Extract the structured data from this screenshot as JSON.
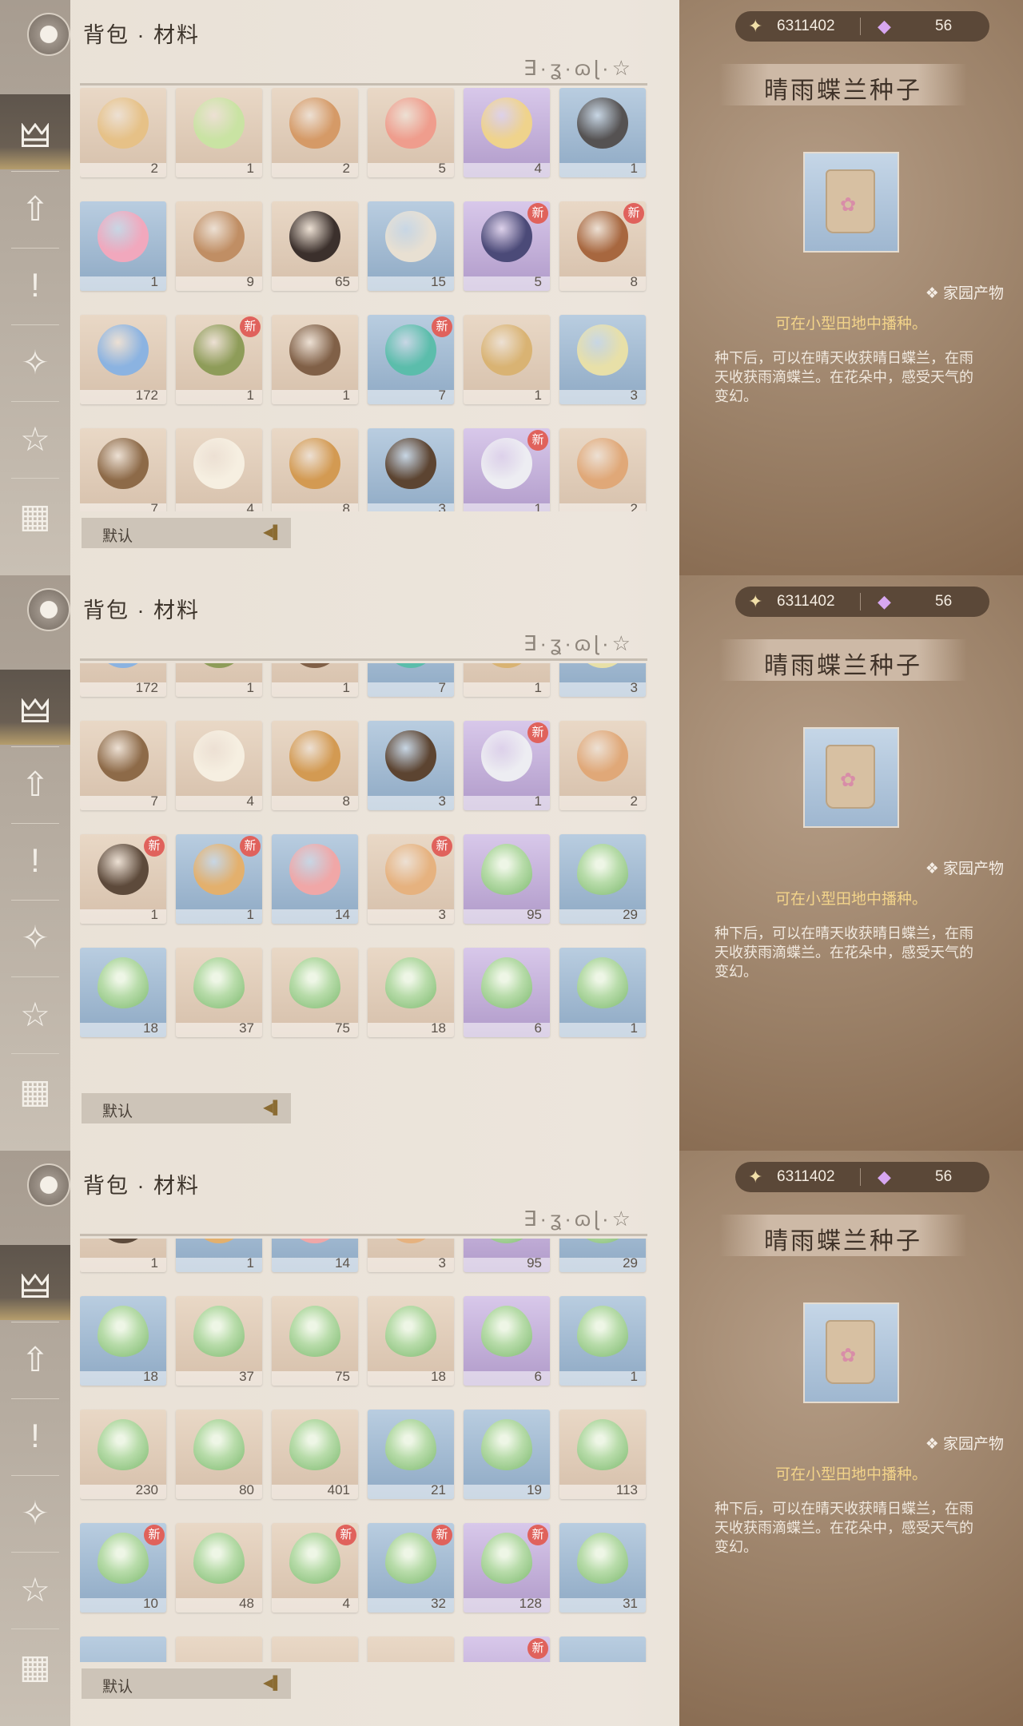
{
  "header": {
    "title": "背包 · 材料",
    "deco_text": "∃·ʓ·ɷɭ·☆"
  },
  "currency": {
    "star_icon": "star-icon",
    "star_value": "6311402",
    "gem_icon": "gem-icon",
    "gem_value": "56"
  },
  "sidebar": {
    "items": [
      {
        "name": "materials",
        "icon": "🜲"
      },
      {
        "name": "upgrade",
        "icon": "⇧"
      },
      {
        "name": "quest",
        "icon": "!"
      },
      {
        "name": "feather",
        "icon": "✧"
      },
      {
        "name": "star",
        "icon": "☆"
      },
      {
        "name": "cube",
        "icon": "▦"
      }
    ]
  },
  "detail": {
    "item_name": "晴雨蝶兰种子",
    "category": "❖ 家园产物",
    "hint": "可在小型田地中播种。",
    "description": "种下后，可以在晴天收获晴日蝶兰，在雨天收获雨滴蝶兰。在花朵中，感受天气的变幻。"
  },
  "sort": {
    "label": "默认"
  },
  "panels": [
    {
      "rows": [
        [
          {
            "c": "2",
            "q": "tan",
            "col": "#e6c187"
          },
          {
            "c": "1",
            "q": "tan",
            "col": "#c9e3a3"
          },
          {
            "c": "2",
            "q": "tan",
            "col": "#d59a67"
          },
          {
            "c": "5",
            "q": "tan",
            "col": "#ef9d8d"
          },
          {
            "c": "4",
            "q": "purple",
            "col": "#efd38c"
          },
          {
            "c": "1",
            "q": "blue",
            "col": "#555252"
          }
        ],
        [
          {
            "c": "1",
            "q": "blue",
            "col": "#f1a8bd"
          },
          {
            "c": "9",
            "q": "tan",
            "col": "#c08e64"
          },
          {
            "c": "65",
            "q": "tan",
            "col": "#3b302c"
          },
          {
            "c": "15",
            "q": "blue",
            "col": "#e8e0d2"
          },
          {
            "c": "5",
            "q": "purple",
            "col": "#4b4a78",
            "n": "新"
          },
          {
            "c": "8",
            "q": "tan",
            "col": "#a7673f",
            "n": "新"
          }
        ],
        [
          {
            "c": "172",
            "q": "tan",
            "col": "#8bb3e1"
          },
          {
            "c": "1",
            "q": "tan",
            "col": "#8e9c59",
            "n": "新"
          },
          {
            "c": "1",
            "q": "tan",
            "col": "#806047"
          },
          {
            "c": "7",
            "q": "blue",
            "col": "#5bbdab",
            "n": "新"
          },
          {
            "c": "1",
            "q": "tan",
            "col": "#d9b373"
          },
          {
            "c": "3",
            "q": "blue",
            "col": "#e8e0a8"
          }
        ],
        [
          {
            "c": "7",
            "q": "tan",
            "col": "#8d6a48"
          },
          {
            "c": "4",
            "q": "tan",
            "col": "#f6efe1"
          },
          {
            "c": "8",
            "q": "tan",
            "col": "#d39a52"
          },
          {
            "c": "3",
            "q": "blue",
            "col": "#5c4431"
          },
          {
            "c": "1",
            "q": "purple",
            "col": "#ededf2",
            "n": "新"
          },
          {
            "c": "2",
            "q": "tan",
            "col": "#e0a878"
          }
        ]
      ],
      "offset": 0
    },
    {
      "rows": [
        [
          {
            "c": "172",
            "q": "tan",
            "col": "#8bb3e1"
          },
          {
            "c": "1",
            "q": "tan",
            "col": "#8e9c59"
          },
          {
            "c": "1",
            "q": "tan",
            "col": "#806047"
          },
          {
            "c": "7",
            "q": "blue",
            "col": "#5bbdab"
          },
          {
            "c": "1",
            "q": "tan",
            "col": "#d9b373"
          },
          {
            "c": "3",
            "q": "blue",
            "col": "#e8e0a8"
          }
        ],
        [
          {
            "c": "7",
            "q": "tan",
            "col": "#8d6a48"
          },
          {
            "c": "4",
            "q": "tan",
            "col": "#f6efe1"
          },
          {
            "c": "8",
            "q": "tan",
            "col": "#d39a52"
          },
          {
            "c": "3",
            "q": "blue",
            "col": "#5c4431"
          },
          {
            "c": "1",
            "q": "purple",
            "col": "#ededf2",
            "n": "新"
          },
          {
            "c": "2",
            "q": "tan",
            "col": "#e0a878"
          }
        ],
        [
          {
            "c": "1",
            "q": "tan",
            "col": "#5d4a3b",
            "n": "新"
          },
          {
            "c": "1",
            "q": "blue",
            "col": "#e3b06d",
            "n": "新"
          },
          {
            "c": "14",
            "q": "blue",
            "col": "#f0a7a7"
          },
          {
            "c": "3",
            "q": "tan",
            "col": "#e6b27f",
            "n": "新"
          },
          {
            "c": "95",
            "q": "purple",
            "seed": true
          },
          {
            "c": "29",
            "q": "blue",
            "seed": true
          }
        ],
        [
          {
            "c": "18",
            "q": "blue",
            "seed": true
          },
          {
            "c": "37",
            "q": "tan",
            "seed": true
          },
          {
            "c": "75",
            "q": "tan",
            "seed": true
          },
          {
            "c": "18",
            "q": "tan",
            "seed": true
          },
          {
            "c": "6",
            "q": "purple",
            "seed": true
          },
          {
            "c": "1",
            "q": "blue",
            "seed": true
          }
        ]
      ],
      "offset": -70
    },
    {
      "rows": [
        [
          {
            "c": "1",
            "q": "tan",
            "col": "#5d4a3b"
          },
          {
            "c": "1",
            "q": "blue",
            "col": "#e3b06d"
          },
          {
            "c": "14",
            "q": "blue",
            "col": "#f0a7a7"
          },
          {
            "c": "3",
            "q": "tan",
            "col": "#e6b27f"
          },
          {
            "c": "95",
            "q": "purple",
            "seed": true
          },
          {
            "c": "29",
            "q": "blue",
            "seed": true
          }
        ],
        [
          {
            "c": "18",
            "q": "blue",
            "seed": true
          },
          {
            "c": "37",
            "q": "tan",
            "seed": true
          },
          {
            "c": "75",
            "q": "tan",
            "seed": true
          },
          {
            "c": "18",
            "q": "tan",
            "seed": true
          },
          {
            "c": "6",
            "q": "purple",
            "seed": true
          },
          {
            "c": "1",
            "q": "blue",
            "seed": true
          }
        ],
        [
          {
            "c": "230",
            "q": "tan",
            "seed": true
          },
          {
            "c": "80",
            "q": "tan",
            "seed": true
          },
          {
            "c": "401",
            "q": "tan",
            "seed": true
          },
          {
            "c": "21",
            "q": "blue",
            "seed": true
          },
          {
            "c": "19",
            "q": "blue",
            "seed": true
          },
          {
            "c": "113",
            "q": "tan",
            "seed": true
          }
        ],
        [
          {
            "c": "10",
            "q": "blue",
            "seed": true,
            "n": "新"
          },
          {
            "c": "48",
            "q": "tan",
            "seed": true
          },
          {
            "c": "4",
            "q": "tan",
            "seed": true,
            "n": "新"
          },
          {
            "c": "32",
            "q": "blue",
            "seed": true,
            "n": "新"
          },
          {
            "c": "128",
            "q": "purple",
            "seed": true,
            "n": "新"
          },
          {
            "c": "31",
            "q": "blue",
            "seed": true
          }
        ],
        [
          {
            "c": "",
            "q": "blue"
          },
          {
            "c": "",
            "q": "tan"
          },
          {
            "c": "",
            "q": "tan"
          },
          {
            "c": "",
            "q": "tan"
          },
          {
            "c": "",
            "q": "purple",
            "n": "新"
          },
          {
            "c": "",
            "q": "blue"
          }
        ]
      ],
      "offset": -70
    }
  ]
}
